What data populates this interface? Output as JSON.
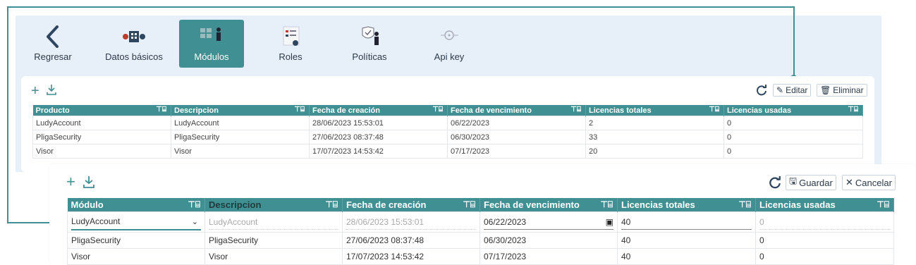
{
  "nav": {
    "items": [
      {
        "label": "Regresar",
        "icon": "back-arrow-icon"
      },
      {
        "label": "Datos básicos",
        "icon": "basic-data-icon"
      },
      {
        "label": "Módulos",
        "icon": "modules-icon"
      },
      {
        "label": "Roles",
        "icon": "roles-icon"
      },
      {
        "label": "Políticas",
        "icon": "policies-icon"
      },
      {
        "label": "Api key",
        "icon": "api-key-icon"
      }
    ],
    "active": "Módulos"
  },
  "top_toolbar": {
    "edit_label": "Editar",
    "delete_label": "Eliminar"
  },
  "top_table": {
    "columns": [
      "Producto",
      "Descripcion",
      "Fecha de creación",
      "Fecha de vencimiento",
      "Licencias totales",
      "Licencias usadas"
    ],
    "rows": [
      [
        "LudyAccount",
        "LudyAccount",
        "28/06/2023 15:53:01",
        "06/22/2023",
        "2",
        "0"
      ],
      [
        "PligaSecurity",
        "PligaSecurity",
        "27/06/2023 08:37:48",
        "06/30/2023",
        "33",
        "0"
      ],
      [
        "Visor",
        "Visor",
        "17/07/2023 14:53:42",
        "07/17/2023",
        "20",
        "0"
      ]
    ]
  },
  "edit_toolbar": {
    "save_label": "Guardar",
    "cancel_label": "Cancelar"
  },
  "edit_table": {
    "columns": [
      "Módulo",
      "Descripcion",
      "Fecha de creación",
      "Fecha de vencimiento",
      "Licencias totales",
      "Licencias usadas"
    ],
    "edit_row": {
      "module": "LudyAccount",
      "description": "LudyAccount",
      "created": "28/06/2023 15:53:01",
      "expires": "06/22/2023",
      "total": "40",
      "used": "0"
    },
    "rows": [
      [
        "PligaSecurity",
        "PligaSecurity",
        "27/06/2023 08:37:48",
        "06/30/2023",
        "40",
        "0"
      ],
      [
        "Visor",
        "Visor",
        "17/07/2023 14:53:42",
        "07/17/2023",
        "40",
        "0"
      ]
    ]
  },
  "colors": {
    "accent": "#3f8f93",
    "panel_bg": "#e7f0f8"
  }
}
